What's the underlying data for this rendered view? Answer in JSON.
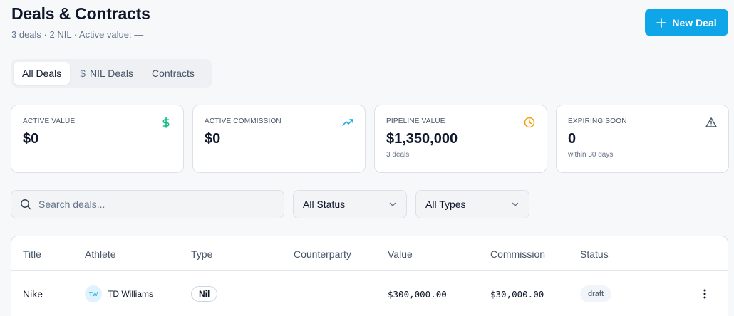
{
  "page": {
    "title": "Deals & Contracts",
    "subtitle": "3 deals · 2 NIL · Active value: —"
  },
  "actions": {
    "new_deal_label": "New Deal"
  },
  "tabs": [
    {
      "label": "All Deals",
      "active": true
    },
    {
      "label": "NIL Deals",
      "icon": "dollar-icon"
    },
    {
      "label": "Contracts"
    }
  ],
  "cards": [
    {
      "label": "ACTIVE VALUE",
      "value": "$0",
      "note": "",
      "icon": "dollar-icon",
      "icon_color": "#10b981"
    },
    {
      "label": "ACTIVE COMMISSION",
      "value": "$0",
      "note": "",
      "icon": "trending-up-icon",
      "icon_color": "#0ea5e9"
    },
    {
      "label": "PIPELINE VALUE",
      "value": "$1,350,000",
      "note": "3 deals",
      "icon": "clock-icon",
      "icon_color": "#f59e0b"
    },
    {
      "label": "EXPIRING SOON",
      "value": "0",
      "note": "within 30 days",
      "icon": "alert-triangle-icon",
      "icon_color": "#475569"
    }
  ],
  "filters": {
    "search_placeholder": "Search deals...",
    "status_value": "All Status",
    "type_value": "All Types"
  },
  "table": {
    "columns": [
      "Title",
      "Athlete",
      "Type",
      "Counterparty",
      "Value",
      "Commission",
      "Status"
    ],
    "rows": [
      {
        "title": "Nike",
        "athlete_initials": "TW",
        "athlete": "TD Williams",
        "type": "Nil",
        "counterparty": "—",
        "value": "$300,000.00",
        "commission": "$30,000.00",
        "status": "draft"
      }
    ]
  },
  "colors": {
    "accent": "#0ea5e9",
    "background": "#f7f8fa"
  }
}
